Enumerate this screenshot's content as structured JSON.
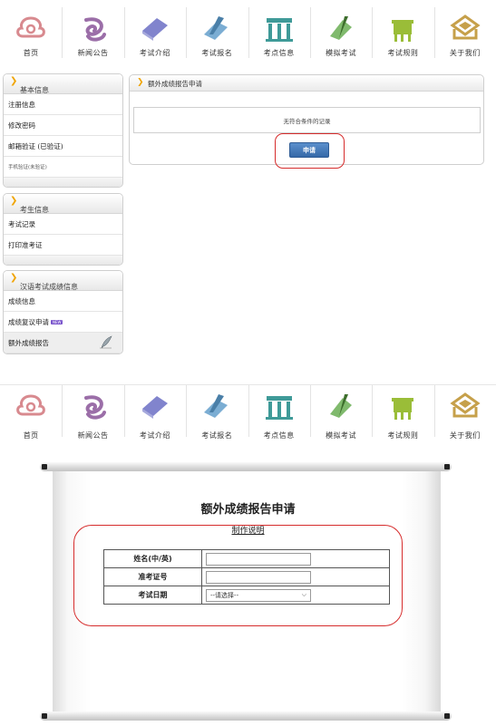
{
  "nav": {
    "items": [
      {
        "label": "首页",
        "icon": "cloud-ornament-icon",
        "color": "#d88a8f"
      },
      {
        "label": "新闻公告",
        "icon": "swirl-icon",
        "color": "#9b6ea8"
      },
      {
        "label": "考试介绍",
        "icon": "scroll-book-icon",
        "color": "#6b6fc4"
      },
      {
        "label": "考试报名",
        "icon": "pen-paper-icon",
        "color": "#5a98c8"
      },
      {
        "label": "考点信息",
        "icon": "pavilion-icon",
        "color": "#3f9a98"
      },
      {
        "label": "模拟考试",
        "icon": "brush-scroll-icon",
        "color": "#6aae54"
      },
      {
        "label": "考试规则",
        "icon": "ding-vessel-icon",
        "color": "#9abd38"
      },
      {
        "label": "关于我们",
        "icon": "box-icon",
        "color": "#c6a04a"
      }
    ]
  },
  "nav2": {
    "items": [
      {
        "label": "首页"
      },
      {
        "label": "新闻公告"
      },
      {
        "label": "考试介绍"
      },
      {
        "label": "考试报名"
      },
      {
        "label": "考点信息"
      },
      {
        "label": "模拟考试"
      },
      {
        "label": "考试规则"
      },
      {
        "label": "关于我们"
      }
    ]
  },
  "sidebar": {
    "basic": {
      "title": "基本信息",
      "items": [
        "注册信息",
        "修改密码",
        "邮箱验证 (已验证)",
        "手机验证(未验证)"
      ]
    },
    "candidate": {
      "title": "考生信息",
      "items": [
        "考试记录",
        "打印准考证"
      ]
    },
    "scores": {
      "title": "汉语考试成绩信息",
      "items": [
        "成绩信息",
        "成绩复议申请",
        "额外成绩报告"
      ],
      "badge": "NEW"
    }
  },
  "main": {
    "title": "额外成绩报告申请",
    "no_record": "无符合条件的记录",
    "apply_button": "申请"
  },
  "form": {
    "title": "额外成绩报告申请",
    "link": "制作说明",
    "name_label": "姓名(中/英)",
    "ticket_label": "准考证号",
    "date_label": "考试日期",
    "date_placeholder": "--请选择--"
  },
  "colors": {
    "accent": "#3569a8",
    "highlight": "#d62c2c",
    "chevron": "#f0a400"
  }
}
